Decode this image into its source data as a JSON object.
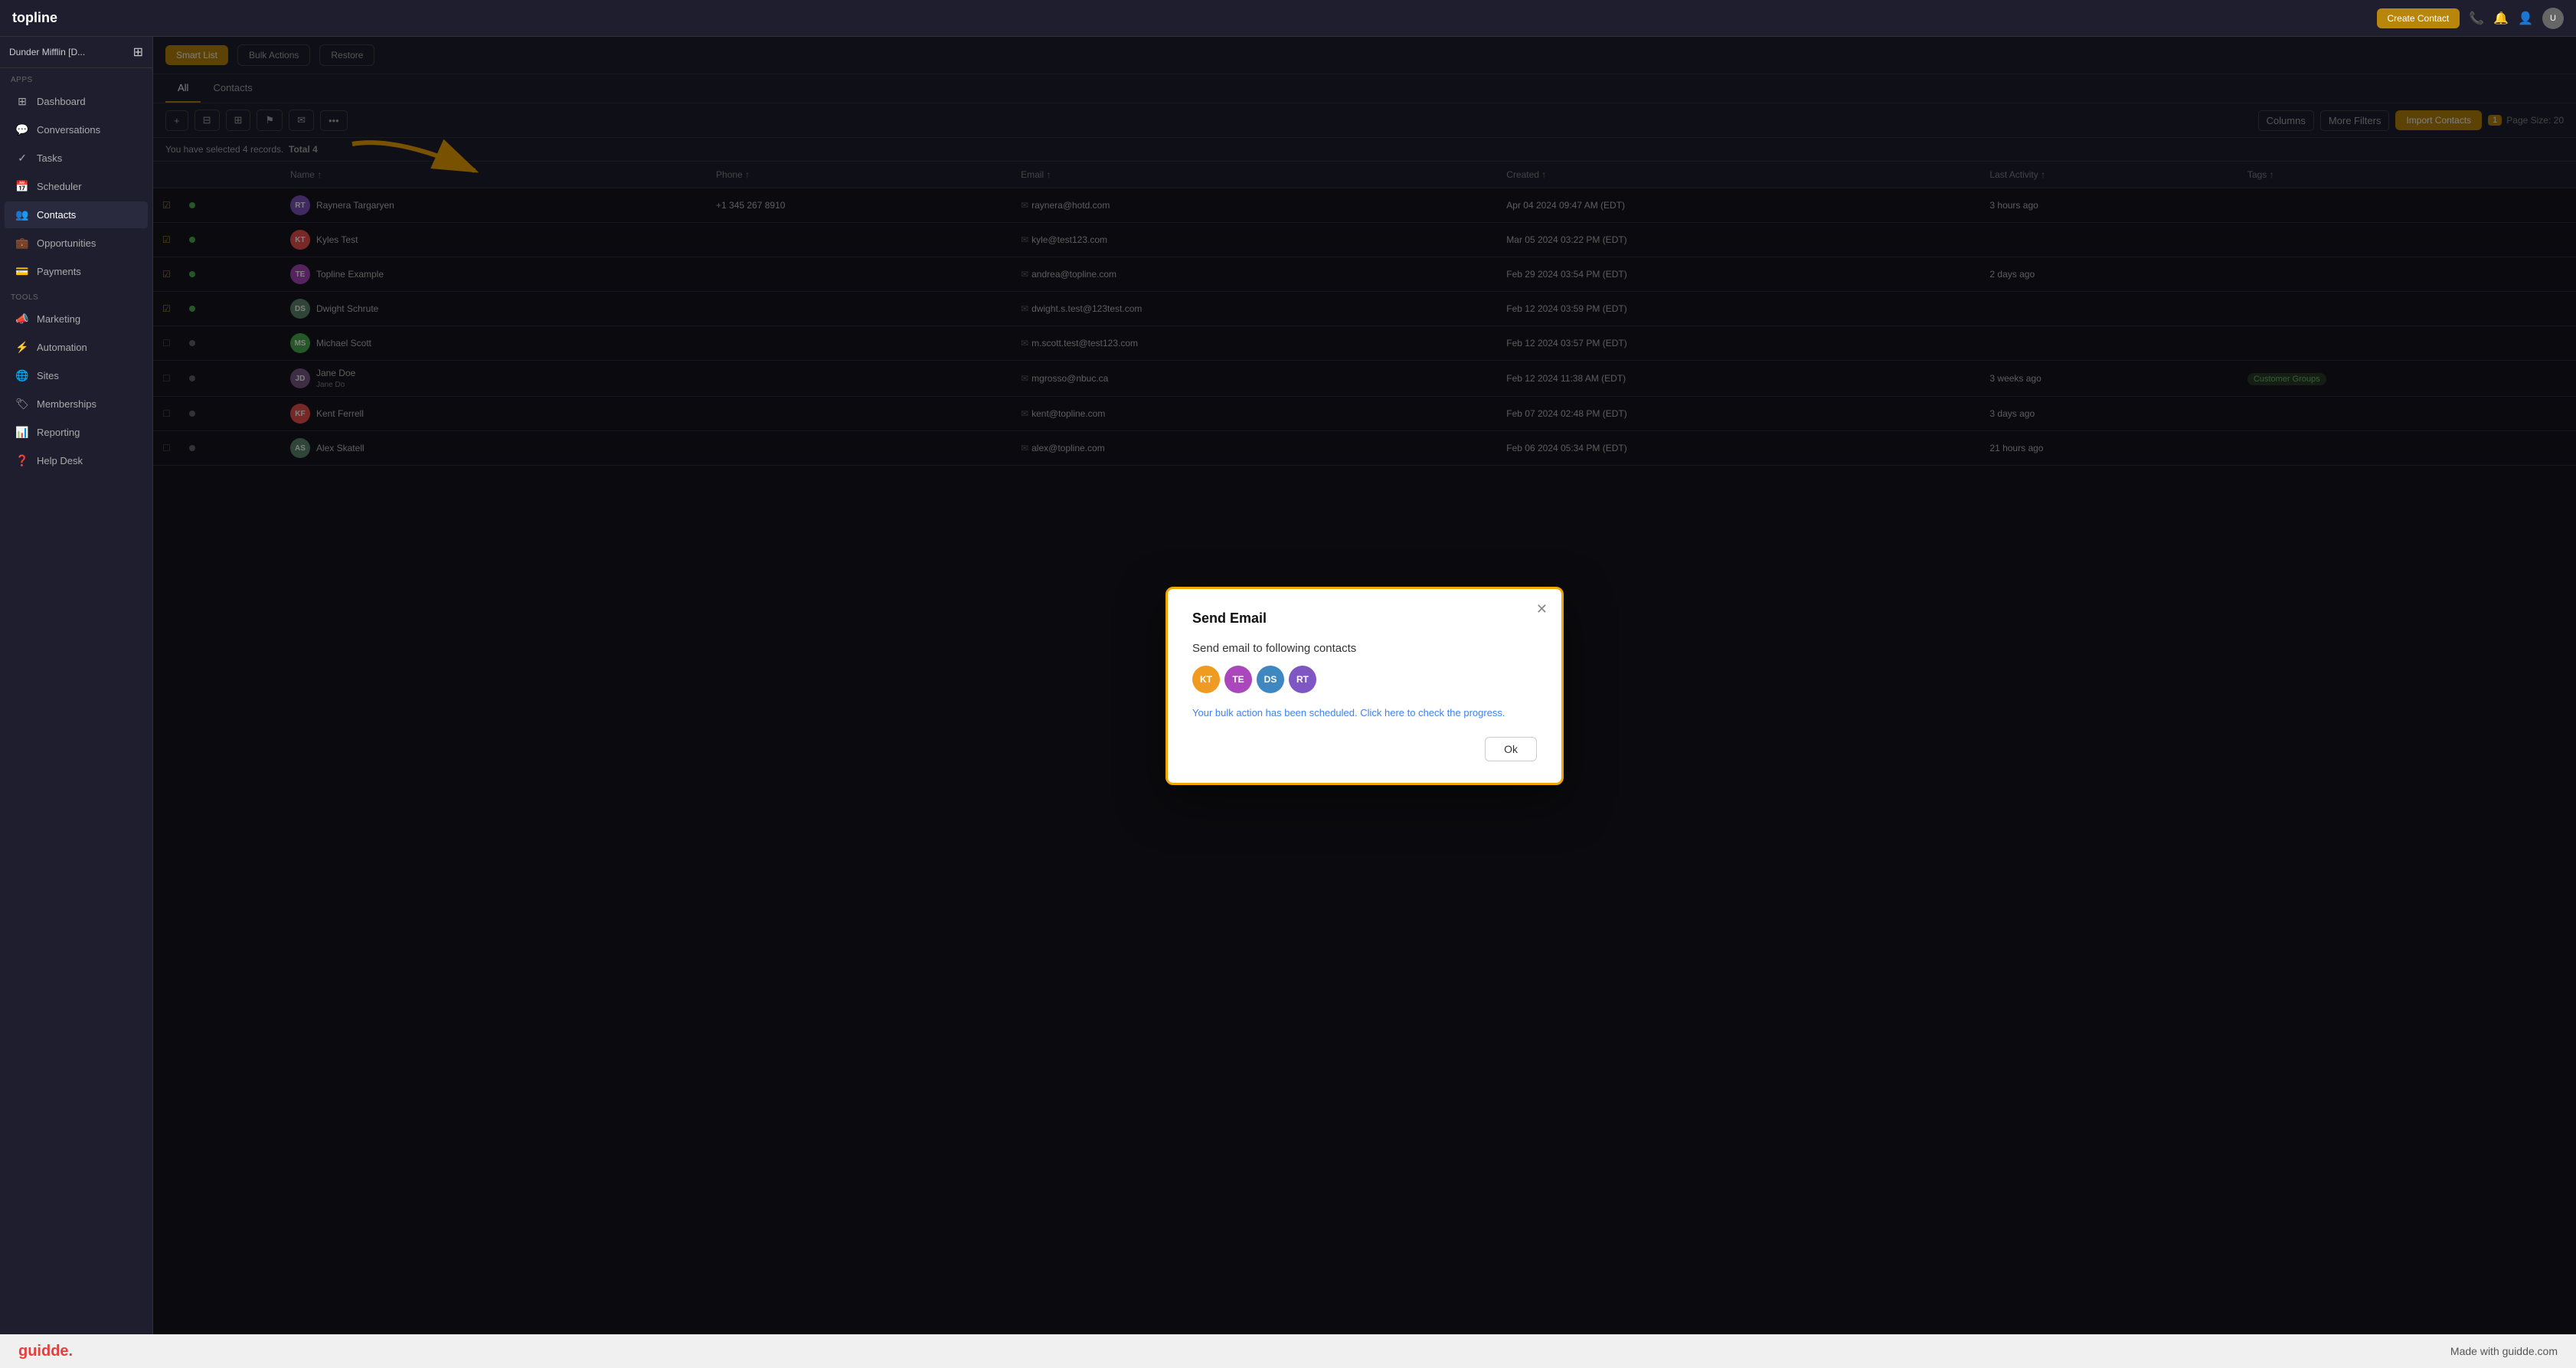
{
  "app": {
    "logo": "topline",
    "top_btn": "Create Contact",
    "workspace": "Dunder Mifflin [D...",
    "icons": {
      "phone": "📞",
      "bell": "🔔",
      "user": "👤"
    }
  },
  "sidebar": {
    "workspace_label": "Dunder Mifflin [D...",
    "apps_section": "Apps",
    "tools_section": "Tools",
    "items": [
      {
        "id": "dashboard",
        "label": "Dashboard",
        "icon": "⊞"
      },
      {
        "id": "conversations",
        "label": "Conversations",
        "icon": "💬"
      },
      {
        "id": "tasks",
        "label": "Tasks",
        "icon": "✓"
      },
      {
        "id": "scheduler",
        "label": "Scheduler",
        "icon": "📅"
      },
      {
        "id": "contacts",
        "label": "Contacts",
        "icon": "👥",
        "active": true
      },
      {
        "id": "opportunities",
        "label": "Opportunities",
        "icon": "💼"
      },
      {
        "id": "payments",
        "label": "Payments",
        "icon": "💳"
      },
      {
        "id": "marketing",
        "label": "Marketing",
        "icon": "📣"
      },
      {
        "id": "automation",
        "label": "Automation",
        "icon": "⚡"
      },
      {
        "id": "sites",
        "label": "Sites",
        "icon": "🌐"
      },
      {
        "id": "memberships",
        "label": "Memberships",
        "icon": "🏷"
      },
      {
        "id": "reporting",
        "label": "Reporting",
        "icon": "📊"
      },
      {
        "id": "help_desk",
        "label": "Help Desk",
        "icon": "❓"
      }
    ]
  },
  "content_header": {
    "btn_smart_list": "Smart List",
    "btn_bulk_actions": "Bulk Actions",
    "btn_restore": "Restore"
  },
  "tabs": [
    {
      "id": "all",
      "label": "All",
      "active": true
    },
    {
      "id": "contacts",
      "label": "Contacts"
    }
  ],
  "toolbar": {
    "add_icon": "+",
    "filter_icon": "⊟",
    "group_icon": "⊞",
    "flag_icon": "⚑",
    "email_icon": "✉",
    "more_icon": "•••",
    "columns_label": "Columns",
    "more_filters_label": "More Filters",
    "import_btn": "Import Contacts"
  },
  "selection_bar": {
    "text": "You have selected 4 records.",
    "total_label": "Total 4"
  },
  "table": {
    "columns": [
      "",
      "",
      "Name",
      "Phone",
      "Email",
      "Created",
      "Last Activity",
      "Tags"
    ],
    "rows": [
      {
        "selected": true,
        "avatar_initials": "RT",
        "avatar_color": "#7e57c2",
        "name": "Raynera Targaryen",
        "phone": "+1 345 267 8910",
        "email": "raynera@hotd.com",
        "created": "Apr 04 2024 09:47 AM (EDT)",
        "last_activity": "3 hours ago",
        "tags": ""
      },
      {
        "selected": true,
        "avatar_initials": "KT",
        "avatar_color": "#ef5350",
        "name": "Kyles Test",
        "phone": "",
        "email": "kyle@test123.com",
        "created": "Mar 05 2024 03:22 PM (EDT)",
        "last_activity": "",
        "tags": ""
      },
      {
        "selected": true,
        "avatar_initials": "TE",
        "avatar_color": "#ab47bc",
        "name": "Topline Example",
        "phone": "",
        "email": "andrea@topline.com",
        "created": "Feb 29 2024 03:54 PM (EDT)",
        "last_activity": "2 days ago",
        "tags": ""
      },
      {
        "selected": true,
        "avatar_initials": "DS",
        "avatar_color": "#5c8a6e",
        "name": "Dwight Schrute",
        "phone": "",
        "email": "dwight.s.test@123test.com",
        "created": "Feb 12 2024 03:59 PM (EDT)",
        "last_activity": "",
        "tags": ""
      },
      {
        "selected": false,
        "avatar_initials": "MS",
        "avatar_color": "#4caf50",
        "name": "Michael Scott",
        "phone": "",
        "email": "m.scott.test@test123.com",
        "created": "Feb 12 2024 03:57 PM (EDT)",
        "last_activity": "",
        "tags": ""
      },
      {
        "selected": false,
        "avatar_initials": "JD",
        "avatar_color": "#7b5c8a",
        "name": "Jane Doe",
        "name_sub": "Jane Do",
        "phone": "",
        "email": "mgrosso@nbuc.ca",
        "created": "Feb 12 2024 11:38 AM (EDT)",
        "last_activity": "3 weeks ago",
        "tags": "Customer Groups"
      },
      {
        "selected": false,
        "avatar_initials": "KF",
        "avatar_color": "#ef5350",
        "name": "Kent Ferrell",
        "phone": "",
        "email": "kent@topline.com",
        "created": "Feb 07 2024 02:48 PM (EDT)",
        "last_activity": "3 days ago",
        "tags": ""
      },
      {
        "selected": false,
        "avatar_initials": "AS",
        "avatar_color": "#5c8a6e",
        "name": "Alex Skatell",
        "phone": "",
        "email": "alex@topline.com",
        "created": "Feb 06 2024 05:34 PM (EDT)",
        "last_activity": "21 hours ago",
        "tags": ""
      }
    ]
  },
  "pagination": {
    "page_size_label": "Page Size: 20"
  },
  "modal": {
    "title": "Send Email",
    "subtitle": "Send email to following contacts",
    "avatars": [
      {
        "initials": "KT",
        "color": "#ef9a20"
      },
      {
        "initials": "TE",
        "color": "#ab47bc"
      },
      {
        "initials": "DS",
        "color": "#3f87c0"
      },
      {
        "initials": "RT",
        "color": "#7e57c2"
      }
    ],
    "progress_msg": "Your bulk action has been scheduled. Click here to check the progress.",
    "ok_label": "Ok"
  },
  "bottom_bar": {
    "logo": "guidde.",
    "tagline": "Made with guidde.com"
  }
}
